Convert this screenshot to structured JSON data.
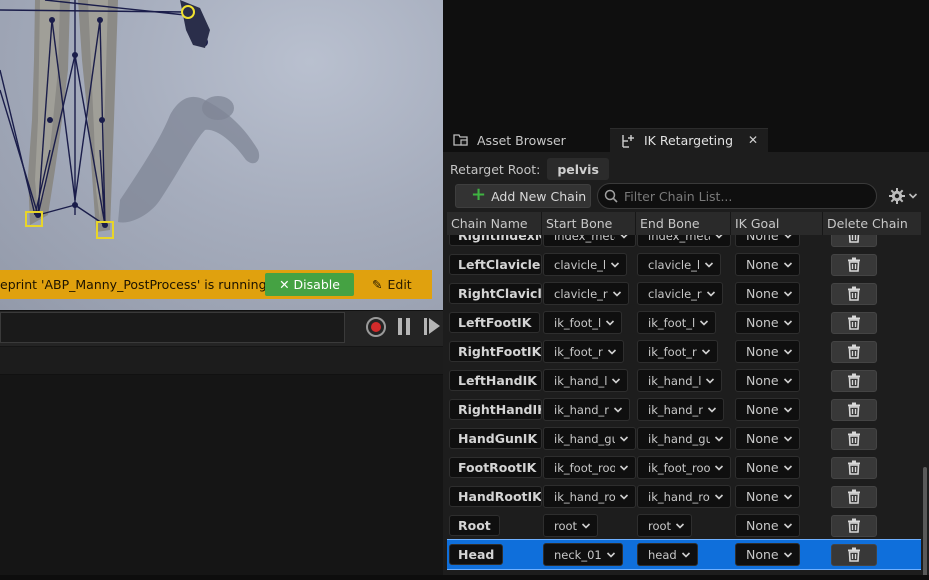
{
  "viewport": {
    "warning_text": "eprint 'ABP_Manny_PostProcess' is running.",
    "disable_label": "Disable",
    "edit_label": "Edit"
  },
  "tabs": [
    {
      "label": "Asset Browser",
      "icon": "asset-browser-icon",
      "active": false
    },
    {
      "label": "IK Retargeting",
      "icon": "ik-retargeting-icon",
      "active": true
    }
  ],
  "retarget_root": {
    "label": "Retarget Root:",
    "value": "pelvis"
  },
  "toolbar": {
    "add_chain_label": "Add New Chain",
    "filter_placeholder": "Filter Chain List..."
  },
  "table": {
    "headers": [
      "Chain Name",
      "Start Bone",
      "End Bone",
      "IK Goal",
      "Delete Chain"
    ],
    "rows": [
      {
        "name": "RightIndexMetacarpal",
        "start": "index_metacarpal_r",
        "end": "index_metacarpal_r",
        "goal": "None"
      },
      {
        "name": "LeftClavicle",
        "start": "clavicle_l",
        "end": "clavicle_l",
        "goal": "None"
      },
      {
        "name": "RightClavicle",
        "start": "clavicle_r",
        "end": "clavicle_r",
        "goal": "None"
      },
      {
        "name": "LeftFootIK",
        "start": "ik_foot_l",
        "end": "ik_foot_l",
        "goal": "None"
      },
      {
        "name": "RightFootIK",
        "start": "ik_foot_r",
        "end": "ik_foot_r",
        "goal": "None"
      },
      {
        "name": "LeftHandIK",
        "start": "ik_hand_l",
        "end": "ik_hand_l",
        "goal": "None"
      },
      {
        "name": "RightHandIK",
        "start": "ik_hand_r",
        "end": "ik_hand_r",
        "goal": "None"
      },
      {
        "name": "HandGunIK",
        "start": "ik_hand_gun",
        "end": "ik_hand_gun",
        "goal": "None"
      },
      {
        "name": "FootRootIK",
        "start": "ik_foot_root",
        "end": "ik_foot_root",
        "goal": "None"
      },
      {
        "name": "HandRootIK",
        "start": "ik_hand_root",
        "end": "ik_hand_root",
        "goal": "None"
      },
      {
        "name": "Root",
        "start": "root",
        "end": "root",
        "goal": "None"
      },
      {
        "name": "Head",
        "start": "neck_01",
        "end": "head",
        "goal": "None",
        "selected": true
      }
    ]
  },
  "colors": {
    "warning_bar": "#e0a10e",
    "disable_button": "#45a243",
    "selection": "#0f6fdb",
    "panel_bg": "#1d1d1d"
  }
}
